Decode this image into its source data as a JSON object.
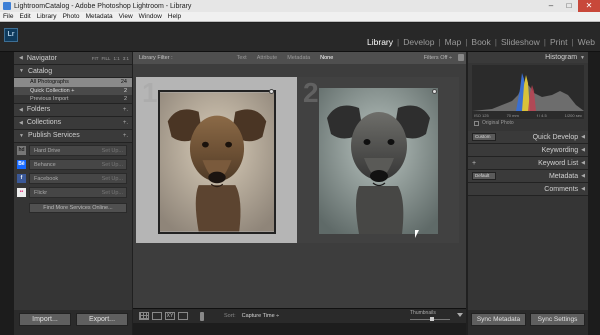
{
  "window": {
    "title": "LightroomCatalog - Adobe Photoshop Lightroom - Library",
    "controls": [
      "–",
      "□",
      "✕"
    ]
  },
  "menu": [
    "File",
    "Edit",
    "Library",
    "Photo",
    "Metadata",
    "View",
    "Window",
    "Help"
  ],
  "identity_plate": {
    "logo": "Lr"
  },
  "modules": {
    "items": [
      "Library",
      "Develop",
      "Map",
      "Book",
      "Slideshow",
      "Print",
      "Web"
    ],
    "active": "Library",
    "separator": "|"
  },
  "navigator": {
    "label": "Navigator",
    "zoom_options": [
      "FIT",
      "FILL",
      "1:1",
      "3:1"
    ]
  },
  "catalog": {
    "label": "Catalog",
    "items": [
      {
        "label": "All Photographs",
        "count": "24"
      },
      {
        "label": "Quick Collection +",
        "count": "2"
      },
      {
        "label": "Previous Import",
        "count": "2"
      }
    ]
  },
  "folders": {
    "label": "Folders",
    "action": "+."
  },
  "collections": {
    "label": "Collections",
    "action": "+."
  },
  "publish_services": {
    "label": "Publish Services",
    "action": "+.",
    "services": [
      {
        "icon": "hd",
        "label": "Hard Drive",
        "setup": "Set Up..."
      },
      {
        "icon": "Bē",
        "label": "Behance",
        "setup": "Set Up..."
      },
      {
        "icon": "f",
        "label": "Facebook",
        "setup": "Set Up..."
      },
      {
        "icon": "••",
        "label": "Flickr",
        "setup": "Set Up..."
      }
    ],
    "find_more": "Find More Services Online..."
  },
  "left_buttons": {
    "import": "Import...",
    "export": "Export..."
  },
  "library_filter": {
    "label": "Library Filter :",
    "options": [
      "Text",
      "Attribute",
      "Metadata",
      "None"
    ],
    "active": "None",
    "filters_off": "Filters Off ÷"
  },
  "grid": {
    "cells": [
      {
        "index": "1",
        "selected": true
      },
      {
        "index": "2",
        "selected": false
      }
    ]
  },
  "toolbar": {
    "sort_label": "Sort:",
    "sort_value": "Capture Time ÷",
    "thumbnails_label": "Thumbnails"
  },
  "histogram": {
    "label": "Histogram",
    "iso": "ISO 125",
    "focal": "70 mm",
    "aperture": "f / 4.5",
    "shutter": "1/200 sec",
    "original_photo": "Original Photo"
  },
  "quick_develop": {
    "label": "Quick Develop",
    "preset": "Custom"
  },
  "keywording": {
    "label": "Keywording"
  },
  "keyword_list": {
    "label": "Keyword List",
    "action": "+"
  },
  "metadata": {
    "label": "Metadata",
    "preset": "Default"
  },
  "comments": {
    "label": "Comments"
  },
  "right_buttons": {
    "sync_metadata": "Sync Metadata",
    "sync_settings": "Sync Settings"
  },
  "colors": {
    "accent_selected": "#8a8a8a",
    "panel": "#353535",
    "background": "#202020",
    "close_button": "#c8483a",
    "histogram_blue": "#3a6fd0",
    "histogram_yellow": "#d8c23a"
  }
}
